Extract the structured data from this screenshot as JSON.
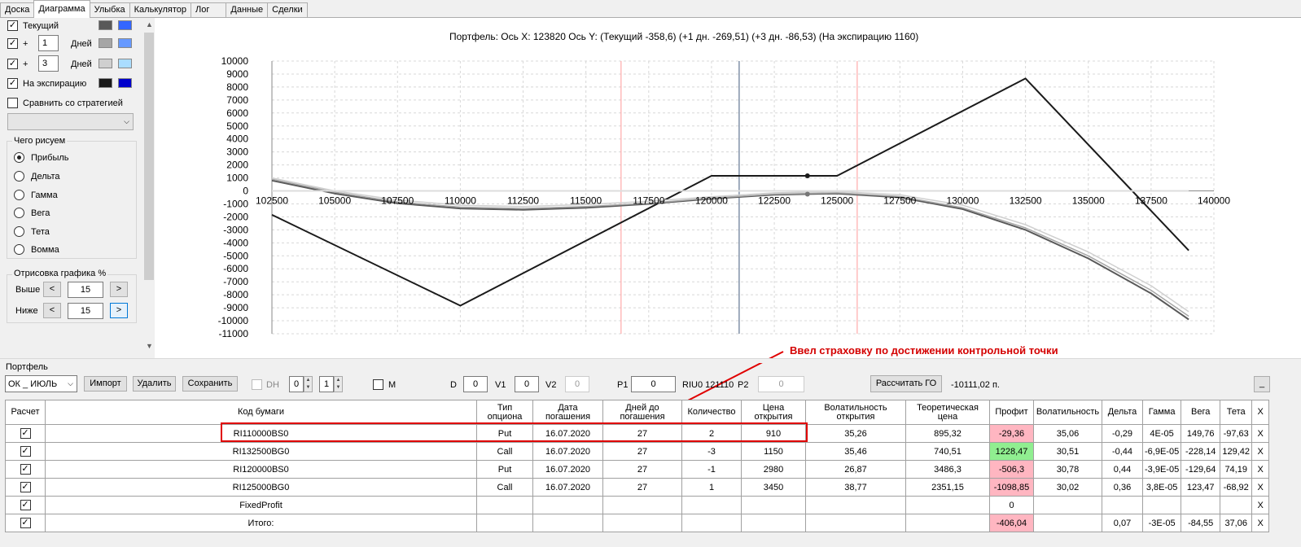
{
  "tabs": [
    "Доска",
    "Диаграмма",
    "Улыбка",
    "Калькулятор",
    "Лог",
    "Данные",
    "Сделки"
  ],
  "active_tab": "Диаграмма",
  "left_panel": {
    "current": {
      "label": "Текущий",
      "color1": "#595959",
      "color2": "#3366ff"
    },
    "plus1": {
      "sign": "+",
      "days": "1",
      "unit": "Дней",
      "color1": "#a6a6a6",
      "color2": "#6699ff"
    },
    "plus3": {
      "sign": "+",
      "days": "3",
      "unit": "Дней",
      "color1": "#cfcfcf",
      "color2": "#aaddff"
    },
    "expiry": {
      "label": "На экспирацию",
      "color1": "#1a1a1a",
      "color2": "#0000cc"
    },
    "compare": {
      "label": "Сравнить со стратегией"
    },
    "draw_group": {
      "title": "Чего рисуем",
      "options": [
        "Прибыль",
        "Дельта",
        "Гамма",
        "Вега",
        "Тета",
        "Вомма"
      ],
      "selected": "Прибыль"
    },
    "render_group": {
      "title": "Отрисовка графика %",
      "above_label": "Выше",
      "above_value": "15",
      "below_label": "Ниже",
      "below_value": "15",
      "left_arrow": "<",
      "right_arrow": ">"
    }
  },
  "chart_title": "Портфель: Ось X: 123820 Ось Y:  (Текущий -358,6)  (+1 дн. -269,51)  (+3 дн. -86,53)  (На экспирацию 1160)",
  "chart_data": {
    "type": "line",
    "xlim": [
      102500,
      140000
    ],
    "ylim": [
      -11000,
      10000
    ],
    "x_ticks": [
      102500,
      105000,
      107500,
      110000,
      112500,
      115000,
      117500,
      120000,
      122500,
      125000,
      127500,
      130000,
      132500,
      135000,
      137500,
      140000
    ],
    "y_ticks": [
      10000,
      9000,
      8000,
      7000,
      6000,
      5000,
      4000,
      3000,
      2000,
      1000,
      0,
      -1000,
      -2000,
      -3000,
      -4000,
      -5000,
      -6000,
      -7000,
      -8000,
      -9000,
      -10000,
      -11000
    ],
    "current_x": 123820,
    "red_lines_x": [
      116400,
      125800
    ],
    "blue_line_x": 121100,
    "series": [
      {
        "key": "expiry",
        "color": "#1a1a1a",
        "width": 2,
        "x": [
          102500,
          110000,
          120000,
          125000,
          132500,
          139000
        ],
        "y": [
          -1840,
          -8840,
          1160,
          1160,
          8660,
          -4590
        ]
      },
      {
        "key": "current",
        "color": "#595959",
        "width": 2,
        "x": [
          102500,
          105000,
          107500,
          110000,
          112500,
          115000,
          117500,
          120000,
          122500,
          125000,
          127500,
          130000,
          132500,
          135000,
          137500,
          139000
        ],
        "y": [
          800,
          -200,
          -950,
          -1350,
          -1450,
          -1300,
          -1000,
          -600,
          -300,
          -200,
          -500,
          -1400,
          -3000,
          -5200,
          -7900,
          -9900
        ]
      },
      {
        "key": "plus1",
        "color": "#a6a6a6",
        "width": 1.5,
        "x": [
          102500,
          105000,
          107500,
          110000,
          112500,
          115000,
          117500,
          120000,
          122500,
          125000,
          127500,
          130000,
          132500,
          135000,
          137500,
          139000
        ],
        "y": [
          900,
          -100,
          -850,
          -1250,
          -1350,
          -1200,
          -950,
          -550,
          -250,
          -150,
          -430,
          -1300,
          -2850,
          -5000,
          -7650,
          -9650
        ]
      },
      {
        "key": "plus3",
        "color": "#cfcfcf",
        "width": 1.5,
        "x": [
          102500,
          105000,
          107500,
          110000,
          112500,
          115000,
          117500,
          120000,
          122500,
          125000,
          127500,
          130000,
          132500,
          135000,
          137500,
          139000
        ],
        "y": [
          1000,
          0,
          -700,
          -1100,
          -1200,
          -1050,
          -800,
          -450,
          -150,
          -50,
          -300,
          -1100,
          -2600,
          -4700,
          -7300,
          -9300
        ]
      },
      {
        "key": "zero",
        "color": "#dddddd",
        "width": 2,
        "x": [
          102500,
          139000
        ],
        "y": [
          0,
          0
        ]
      }
    ]
  },
  "portfolio": {
    "title": "Портфель",
    "combo_value": "ОК _ ИЮЛЬ",
    "import_label": "Импорт",
    "delete_label": "Удалить",
    "save_label": "Сохранить",
    "dh_label": "DH",
    "dh_value1": "0",
    "dh_value2": "1",
    "m_label": "M",
    "d_label": "D",
    "d_value": "0",
    "v1_label": "V1",
    "v1_value": "0",
    "v2_label": "V2",
    "v2_value": "0",
    "p1_label": "P1",
    "p1_value": "0",
    "ticker_label": "RIU0 121110",
    "p2_label": "P2",
    "p2_value": "0",
    "calc_go_label": "Рассчитать ГО",
    "go_value": "-10111,02 п.",
    "min_label": "_"
  },
  "annotation": "Ввел страховку по достижении контрольной точки",
  "table": {
    "headers": [
      "Расчет",
      "Код бумаги",
      "Тип опциона",
      "Дата погашения",
      "Дней до погашения",
      "Количество",
      "Цена открытия",
      "Волатильность открытия",
      "Теоретическая цена",
      "Профит",
      "Волатильность",
      "Дельта",
      "Гамма",
      "Вега",
      "Тета",
      "X"
    ],
    "rows": [
      {
        "code": "RI110000BS0",
        "type": "Put",
        "date": "16.07.2020",
        "days": "27",
        "qty": "2",
        "price": "910",
        "vol_open": "35,26",
        "theo": "895,32",
        "profit": "-29,36",
        "profit_sign": "neg",
        "vol": "35,06",
        "delta": "-0,29",
        "gamma": "4E-05",
        "vega": "149,76",
        "theta": "-97,63",
        "x": "X"
      },
      {
        "code": "RI132500BG0",
        "type": "Call",
        "date": "16.07.2020",
        "days": "27",
        "qty": "-3",
        "price": "1150",
        "vol_open": "35,46",
        "theo": "740,51",
        "profit": "1228,47",
        "profit_sign": "pos",
        "vol": "30,51",
        "delta": "-0,44",
        "gamma": "-6,9E-05",
        "vega": "-228,14",
        "theta": "129,42",
        "x": "X"
      },
      {
        "code": "RI120000BS0",
        "type": "Put",
        "date": "16.07.2020",
        "days": "27",
        "qty": "-1",
        "price": "2980",
        "vol_open": "26,87",
        "theo": "3486,3",
        "profit": "-506,3",
        "profit_sign": "neg",
        "vol": "30,78",
        "delta": "0,44",
        "gamma": "-3,9E-05",
        "vega": "-129,64",
        "theta": "74,19",
        "x": "X"
      },
      {
        "code": "RI125000BG0",
        "type": "Call",
        "date": "16.07.2020",
        "days": "27",
        "qty": "1",
        "price": "3450",
        "vol_open": "38,77",
        "theo": "2351,15",
        "profit": "-1098,85",
        "profit_sign": "neg",
        "vol": "30,02",
        "delta": "0,36",
        "gamma": "3,8E-05",
        "vega": "123,47",
        "theta": "-68,92",
        "x": "X"
      },
      {
        "code": "FixedProfit",
        "type": "",
        "date": "",
        "days": "",
        "qty": "",
        "price": "",
        "vol_open": "",
        "theo": "",
        "profit": "0",
        "profit_sign": "",
        "vol": "",
        "delta": "",
        "gamma": "",
        "vega": "",
        "theta": "",
        "x": "X"
      },
      {
        "code": "Итого:",
        "type": "",
        "date": "",
        "days": "",
        "qty": "",
        "price": "",
        "vol_open": "",
        "theo": "",
        "profit": "-406,04",
        "profit_sign": "neg",
        "vol": "",
        "delta": "0,07",
        "gamma": "-3E-05",
        "vega": "-84,55",
        "theta": "37,06",
        "x": "X"
      }
    ]
  }
}
